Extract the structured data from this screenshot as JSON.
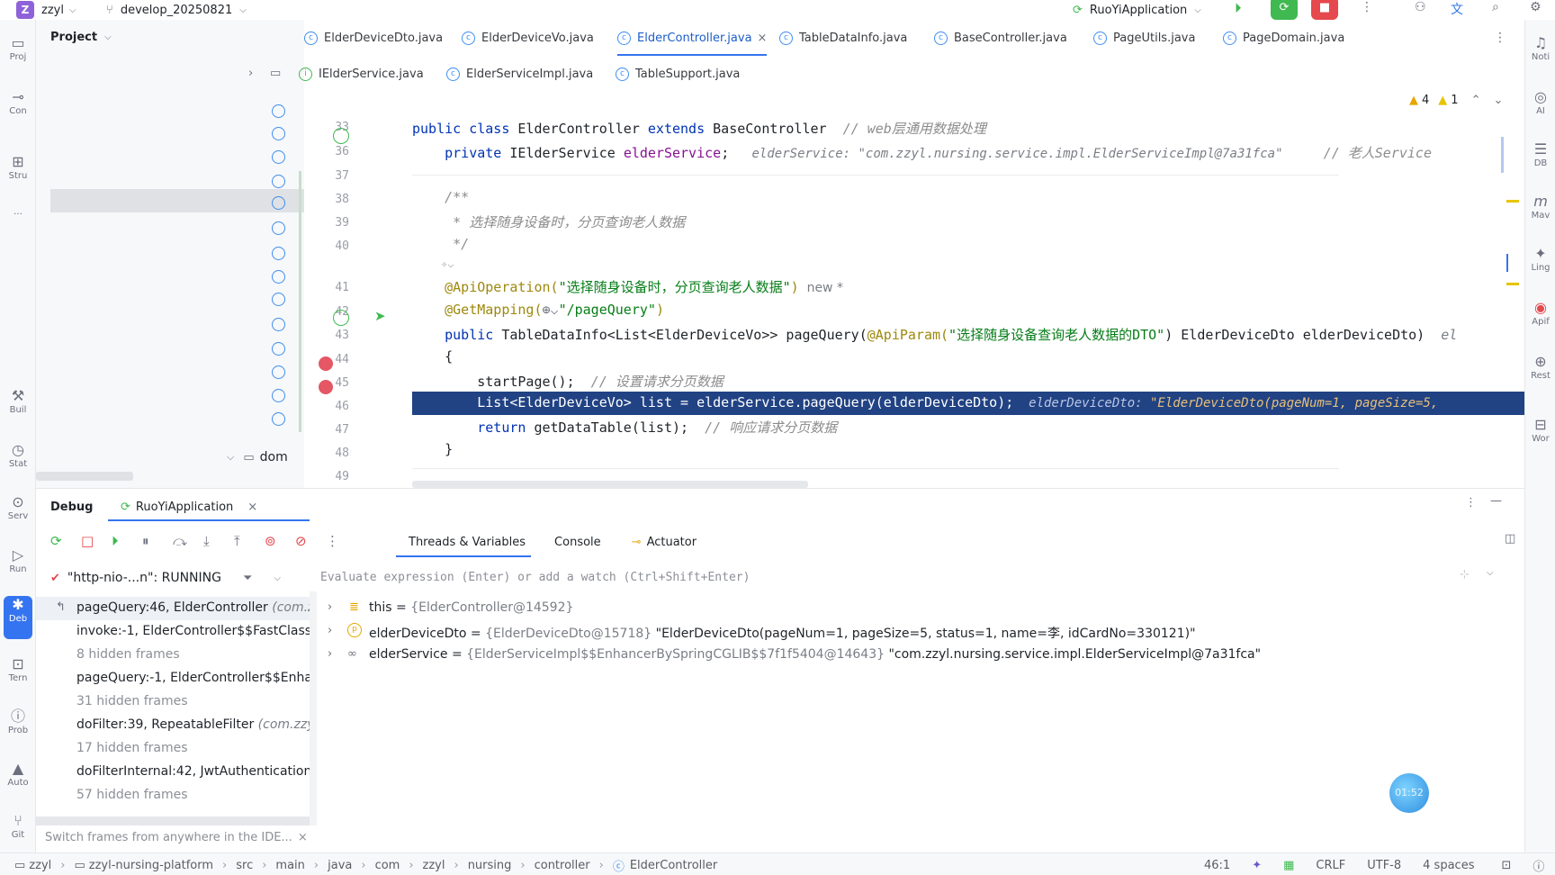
{
  "topbar": {
    "project_badge": "Z",
    "project_name": "zzyl",
    "branch": "develop_20250821",
    "run_config": "RuoYiApplication"
  },
  "left_strip": [
    "Proj",
    "Con",
    "Stru",
    "…",
    "Buil",
    "Stat",
    "Serv",
    "Run",
    "Deb",
    "Tern",
    "Prob",
    "Auto",
    "Git"
  ],
  "right_strip": [
    "Noti",
    "AI",
    "DB",
    "Mav",
    "Ling",
    "Apif",
    "Rest",
    "Wor"
  ],
  "project_panel": {
    "title": "Project",
    "folder_label": "dom"
  },
  "editor": {
    "tabs_row1": [
      "ElderDeviceDto.java",
      "ElderDeviceVo.java",
      "ElderController.java",
      "TableDataInfo.java",
      "BaseController.java",
      "PageUtils.java",
      "PageDomain.java"
    ],
    "tabs_row2": [
      "IElderService.java",
      "ElderServiceImpl.java",
      "TableSupport.java"
    ],
    "active_tab": "ElderController.java",
    "warnings": "4",
    "weak_warnings": "1",
    "line_numbers": [
      "33",
      "36",
      "37",
      "38",
      "39",
      "40",
      "",
      "41",
      "42",
      "43",
      "44",
      "45",
      "46",
      "47",
      "48",
      "49"
    ],
    "code": {
      "l33_a": "public class ",
      "l33_b": "ElderController ",
      "l33_c": "extends ",
      "l33_d": "BaseController",
      "l33_cm": "  // web层通用数据处理",
      "l36_a": "    private ",
      "l36_b": "IElderService ",
      "l36_c": "elderService",
      "l36_d": ";",
      "l36_hint": "   elderService: \"com.zzyl.nursing.service.impl.ElderServiceImpl@7a31fca\"",
      "l36_cm": "     // 老人Service",
      "l38": "    /**",
      "l39": "     * 选择随身设备时，分页查询老人数据",
      "l40": "     */",
      "l41_a": "    @ApiOperation(",
      "l41_b": "\"选择随身设备时，分页查询老人数据\"",
      "l41_c": ")",
      "l41_d": "  new *",
      "l42_a": "    @GetMapping(",
      "l42_b": "\"/pageQuery\"",
      "l42_c": ")",
      "l43_a": "    public ",
      "l43_b": "TableDataInfo<List<ElderDeviceVo>> pageQuery(",
      "l43_c": "@ApiParam(",
      "l43_d": "\"选择随身设备查询老人数据的DTO\"",
      "l43_e": ") ElderDeviceDto elderDeviceDto)",
      "l43_f": "  el",
      "l44": "    {",
      "l45_a": "        startPage();",
      "l45_cm": "  // 设置请求分页数据",
      "l46_a": "        List<ElderDeviceVo> list = elderService.pageQuery(elderDeviceDto);",
      "l46_hint": "  elderDeviceDto: ",
      "l46_hint_str": "\"ElderDeviceDto(pageNum=1, pageSize=5,",
      "l47_a": "        return ",
      "l47_b": "getDataTable(list);",
      "l47_cm": "  // 响应请求分页数据",
      "l48": "    }",
      "l50": "    /**"
    }
  },
  "debug": {
    "title": "Debug",
    "session": "RuoYiApplication",
    "tabs": [
      "Threads & Variables",
      "Console",
      "Actuator"
    ],
    "active_tab": "Threads & Variables",
    "thread": "\"http-nio-...n\": RUNNING",
    "eval_placeholder": "Evaluate expression (Enter) or add a watch (Ctrl+Shift+Enter)",
    "frames": [
      {
        "text": "pageQuery:46, ElderController",
        "extra": " (com.zz",
        "hidden": false
      },
      {
        "text": "invoke:-1, ElderController$$FastClassB",
        "extra": "",
        "hidden": false
      },
      {
        "text": "8 hidden frames",
        "extra": "",
        "hidden": true
      },
      {
        "text": "pageQuery:-1, ElderController$$Enhar",
        "extra": "",
        "hidden": false
      },
      {
        "text": "31 hidden frames",
        "extra": "",
        "hidden": true
      },
      {
        "text": "doFilter:39, RepeatableFilter",
        "extra": " (com.zzyl",
        "hidden": false
      },
      {
        "text": "17 hidden frames",
        "extra": "",
        "hidden": true
      },
      {
        "text": "doFilterInternal:42, JwtAuthentication",
        "extra": "",
        "hidden": false
      },
      {
        "text": "57 hidden frames",
        "extra": "",
        "hidden": true
      }
    ],
    "switch_hint": "Switch frames from anywhere in the IDE...",
    "variables": [
      {
        "name": "this",
        "eq": " = ",
        "type": "{ElderController@14592}",
        "value": ""
      },
      {
        "name": "elderDeviceDto",
        "eq": " = ",
        "type": "{ElderDeviceDto@15718} ",
        "value": "\"ElderDeviceDto(pageNum=1, pageSize=5, status=1, name=李, idCardNo=330121)\""
      },
      {
        "name": "elderService",
        "eq": " = ",
        "type": "{ElderServiceImpl$$EnhancerBySpringCGLIB$$7f1f5404@14643} ",
        "value": "\"com.zzyl.nursing.service.impl.ElderServiceImpl@7a31fca\""
      }
    ],
    "timer": "01:52"
  },
  "statusbar": {
    "breadcrumb": [
      "zzyl",
      "zzyl-nursing-platform",
      "src",
      "main",
      "java",
      "com",
      "zzyl",
      "nursing",
      "controller",
      "ElderController"
    ],
    "position": "46:1",
    "line_sep": "CRLF",
    "encoding": "UTF-8",
    "indent": "4 spaces"
  },
  "colors": {
    "accent": "#3574f0",
    "selection": "#214283",
    "breakpoint": "#e55765",
    "run_green": "#3fb950",
    "stop_red": "#e5484d"
  }
}
